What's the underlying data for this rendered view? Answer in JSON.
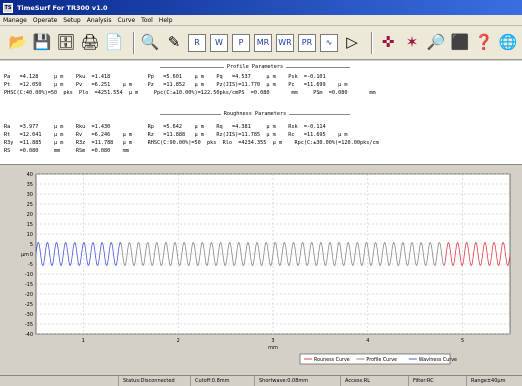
{
  "app": {
    "title": "TimeSurf For TR300 v1.0",
    "icon_label": "TS"
  },
  "menu": [
    "Manage",
    "Operate",
    "Setup",
    "Analysis",
    "Curve",
    "Tool",
    "Help"
  ],
  "toolbar_icons": [
    "open-folder-icon",
    "save-icon",
    "database-icon",
    "print-icon",
    "print-preview-icon",
    "search-icon",
    "tools-icon",
    "curve-r-icon",
    "curve-w-icon",
    "curve-p-icon",
    "curve-mr-icon",
    "curve-wr-icon",
    "curve-pr-icon",
    "curve-wave-icon",
    "arrow-icon",
    "crosshair-icon",
    "star-icon",
    "zoom-icon",
    "monitor-icon",
    "help-icon",
    "globe-icon"
  ],
  "profile": {
    "header": "Profile Parameters",
    "rows": [
      "Pa   =4.128     μ m    Pku  =1.418            Pp   =5.601    μ m    Pq   =4.537     μ m    Psk  =-0.101",
      "Pt   =12.050    μ m    Pv   =6.251    μ m     Pz   =11.852   μ m    Pz(JIS)=11.770  μ m    Pc   =11.699    μ m",
      "PHSC(C:40.00%)=50  pks  Plo  =4251.554  μ m     Ppc(C:±10.00%)=122.50pks/cmPS  =0.080       mm     PSm  =0.080       mm"
    ]
  },
  "roughness": {
    "header": "Roughness Parameters",
    "rows": [
      "Ra   =3.977     μ m    Rku  =1.430            Rp   =5.642    μ m    Rq   =4.381     μ m    Rsk  =-0.114",
      "Rt   =12.041    μ m    Rv   =6.246    μ m     Rz   =11.888   μ m    Rz(JIS)=11.785  μ m    Rc   =11.695    μ m",
      "R3y  =11.885    μ m    R3z  =11.788   μ m     RHSC(C:90.00%)=50  pks  Rlo  =4234.355  μ m    Rpc(C:±30.00%)=120.00pks/cm",
      "RS   =0.080     mm     RSm  =0.080    mm"
    ]
  },
  "chart_data": {
    "type": "line",
    "ylabel": "μm",
    "xlabel": "mm",
    "y_ticks": [
      40,
      35,
      30,
      25,
      20,
      15,
      10,
      5,
      0,
      -5,
      -10,
      -15,
      -20,
      -25,
      -30,
      -35,
      -40
    ],
    "x_ticks": [
      1,
      2,
      3,
      4,
      5
    ],
    "ylim": [
      -40,
      40
    ],
    "xlim": [
      0.5,
      5.5
    ],
    "grid": true,
    "legend_placement": "bottom-right",
    "series": [
      {
        "name": "Rouness Curve",
        "color": "#e0404a",
        "amplitude": 5.8,
        "cycles": 52
      },
      {
        "name": "Profile Curve",
        "color": "#8a8a8a",
        "amplitude": 5.8,
        "cycles": 52
      },
      {
        "name": "Waviness Curve",
        "color": "#4a5adc",
        "amplitude": 5.8,
        "cycles": 52
      }
    ]
  },
  "status": {
    "state": "Status:Disconnected",
    "cutoff": "Cutoff:0.8mm",
    "shortwave": "Shortwave:0.08mm",
    "access": "Access:RL",
    "filter": "Filter:RC",
    "range": "Range±40μm"
  }
}
